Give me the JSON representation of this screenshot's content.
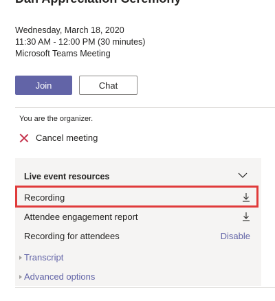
{
  "meeting": {
    "title": "Dan Appreciation Ceremony",
    "date": "Wednesday, March 18, 2020",
    "time": "11:30 AM - 12:00 PM (30 minutes)",
    "type": "Microsoft Teams Meeting"
  },
  "actions": {
    "join_label": "Join",
    "chat_label": "Chat"
  },
  "organizer": {
    "note": "You are the organizer.",
    "cancel_label": "Cancel meeting"
  },
  "resources": {
    "header": "Live event resources",
    "rows": [
      {
        "label": "Recording",
        "action_icon": "download-icon",
        "highlighted": true
      },
      {
        "label": "Attendee engagement report",
        "action_icon": "download-icon"
      },
      {
        "label": "Recording for attendees",
        "action_text": "Disable"
      }
    ],
    "expanders": [
      {
        "label": "Transcript"
      },
      {
        "label": "Advanced options"
      }
    ]
  },
  "colors": {
    "accent": "#6264a7",
    "highlight_border": "#e03b3b",
    "cancel_icon": "#c4314b",
    "panel_bg": "#f5f4f3"
  }
}
